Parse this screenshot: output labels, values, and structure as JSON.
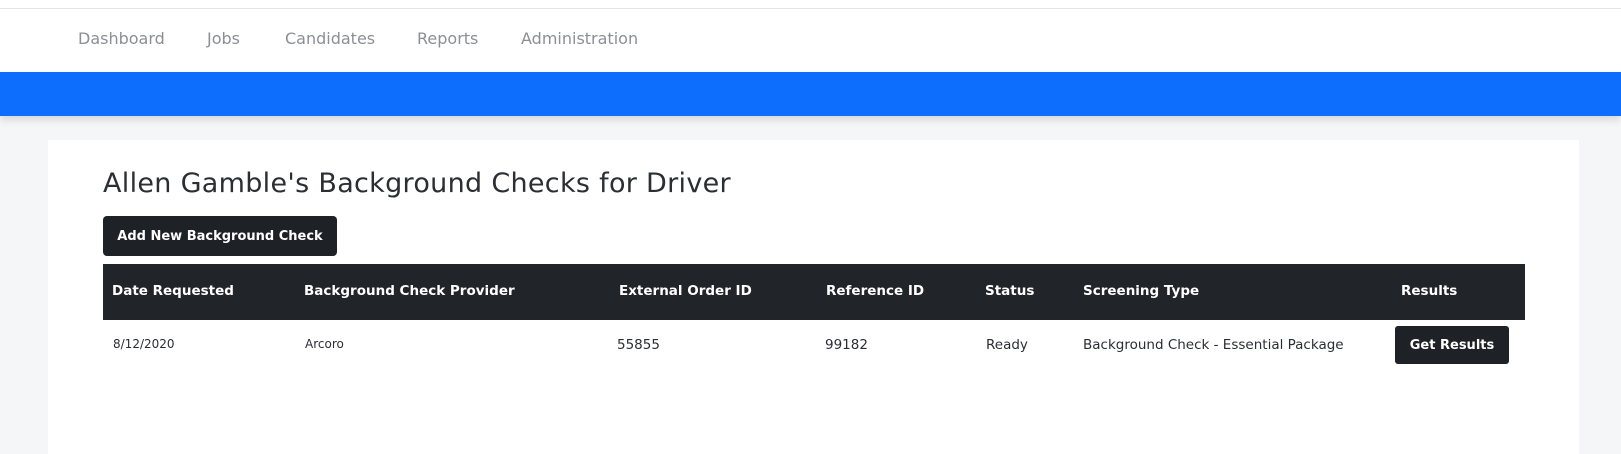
{
  "nav": {
    "items": [
      {
        "label": "Dashboard"
      },
      {
        "label": "Jobs"
      },
      {
        "label": "Candidates"
      },
      {
        "label": "Reports"
      },
      {
        "label": "Administration"
      }
    ]
  },
  "page": {
    "title": "Allen Gamble's Background Checks for Driver",
    "add_button_label": "Add New Background Check"
  },
  "table": {
    "headers": [
      "Date Requested",
      "Background Check Provider",
      "External Order ID",
      "Reference ID",
      "Status",
      "Screening Type",
      "Results"
    ],
    "rows": [
      {
        "date_requested": "8/12/2020",
        "provider": "Arcoro",
        "external_order_id": "55855",
        "reference_id": "99182",
        "status": "Ready",
        "screening_type": "Background Check - Essential Package",
        "results_button_label": "Get Results"
      }
    ]
  },
  "colors": {
    "accent_blue": "#0d6efd",
    "dark": "#212529",
    "nav_text": "#8c8f94"
  }
}
